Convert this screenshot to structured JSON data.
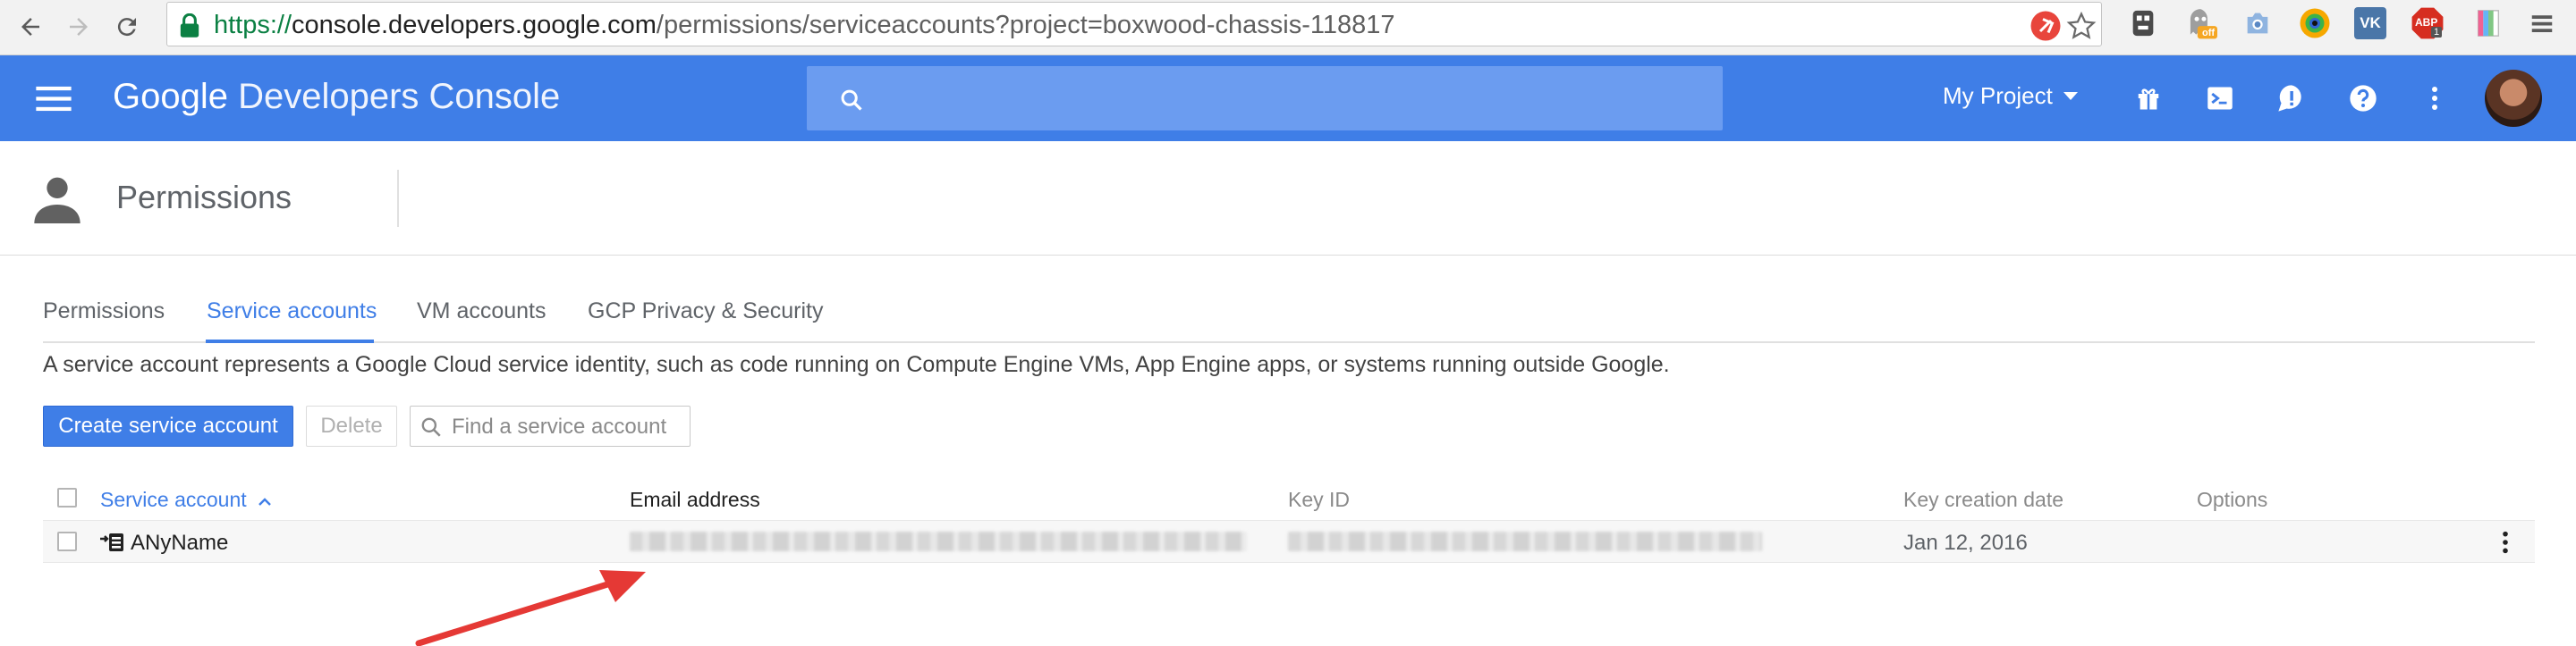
{
  "browser": {
    "url_scheme": "https://",
    "url_host": "console.developers.google.com",
    "url_path": "/permissions/serviceaccounts?project=boxwood-chassis-118817",
    "extensions": [
      "adblock-badge-icon",
      "star-icon",
      "extension-1-icon",
      "ghostery-icon",
      "camera-icon",
      "chrome-color-icon",
      "vk-icon",
      "abp-icon",
      "bookmark-icon",
      "menu-icon"
    ],
    "ghostery_badge": "off",
    "vk_label": "VK",
    "abp_label": "ABP",
    "abp_badge": "1"
  },
  "appbar": {
    "brand_google": "Google",
    "brand_product": "Developers Console",
    "search_placeholder": "",
    "project_label": "My Project"
  },
  "page": {
    "title": "Permissions"
  },
  "tabs": [
    {
      "label": "Permissions"
    },
    {
      "label": "Service accounts",
      "active": true
    },
    {
      "label": "VM accounts"
    },
    {
      "label": "GCP Privacy & Security"
    }
  ],
  "description": "A service account represents a Google Cloud service identity, such as code running on Compute Engine VMs, App Engine apps, or systems running outside Google.",
  "toolbar": {
    "create_label": "Create service account",
    "delete_label": "Delete",
    "find_placeholder": "Find a service account"
  },
  "table": {
    "columns": {
      "service_account": "Service account",
      "email": "Email address",
      "key_id": "Key ID",
      "key_date": "Key creation date",
      "options": "Options"
    },
    "rows": [
      {
        "name": "ANyName",
        "email": "",
        "key_id": "",
        "key_date": "Jan 12, 2016"
      }
    ]
  },
  "colors": {
    "primary": "#3f7ee7",
    "annotation_arrow": "#e53935"
  }
}
